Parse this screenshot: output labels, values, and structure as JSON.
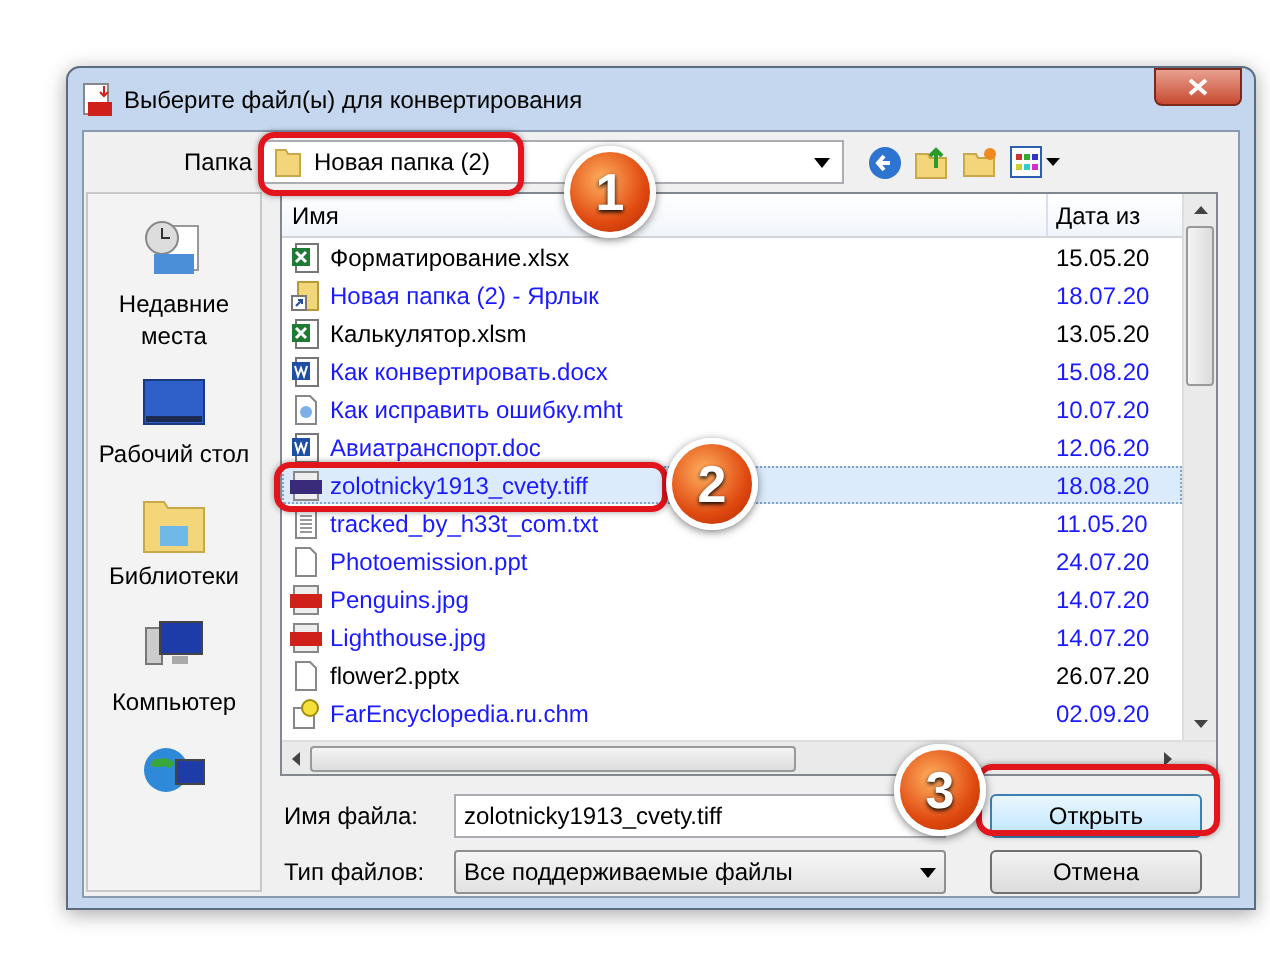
{
  "window": {
    "title": "Выберите файл(ы) для конвертирования"
  },
  "folder": {
    "label": "Папка",
    "value": "Новая папка (2)"
  },
  "places": [
    {
      "kind": "recent",
      "label": "Недавние места"
    },
    {
      "kind": "desktop",
      "label": "Рабочий стол"
    },
    {
      "kind": "libraries",
      "label": "Библиотеки"
    },
    {
      "kind": "computer",
      "label": "Компьютер"
    },
    {
      "kind": "network"
    }
  ],
  "table": {
    "columns": [
      "Имя",
      "Дата из"
    ],
    "rows": [
      {
        "kind": "excel",
        "name": "Форматирование.xlsx",
        "date": "15.05.20",
        "compressed": false,
        "selected": false
      },
      {
        "kind": "shortcut",
        "name": "Новая папка (2) - Ярлык",
        "date": "18.07.20",
        "compressed": true,
        "selected": false
      },
      {
        "kind": "excel",
        "name": "Калькулятор.xlsm",
        "date": "13.05.20",
        "compressed": false,
        "selected": false
      },
      {
        "kind": "word",
        "name": "Как конвертировать.docx",
        "date": "15.08.20",
        "compressed": true,
        "selected": false
      },
      {
        "kind": "web",
        "name": "Как исправить ошибку.mht",
        "date": "10.07.20",
        "compressed": true,
        "selected": false
      },
      {
        "kind": "word",
        "name": "Авиатранспорт.doc",
        "date": "12.06.20",
        "compressed": true,
        "selected": false
      },
      {
        "kind": "tiff",
        "name": "zolotnicky1913_cvety.tiff",
        "date": "18.08.20",
        "compressed": true,
        "selected": true
      },
      {
        "kind": "text",
        "name": "tracked_by_h33t_com.txt",
        "date": "11.05.20",
        "compressed": true,
        "selected": false
      },
      {
        "kind": "blank",
        "name": "Photoemission.ppt",
        "date": "24.07.20",
        "compressed": true,
        "selected": false
      },
      {
        "kind": "jpg",
        "name": "Penguins.jpg",
        "date": "14.07.20",
        "compressed": true,
        "selected": false
      },
      {
        "kind": "jpg",
        "name": "Lighthouse.jpg",
        "date": "14.07.20",
        "compressed": true,
        "selected": false
      },
      {
        "kind": "blank",
        "name": "flower2.pptx",
        "date": "26.07.20",
        "compressed": false,
        "selected": false
      },
      {
        "kind": "help",
        "name": "FarEncyclopedia.ru.chm",
        "date": "02.09.20",
        "compressed": true,
        "selected": false
      }
    ]
  },
  "file_name": {
    "label": "Имя файла:",
    "value": "zolotnicky1913_cvety.tiff"
  },
  "file_type": {
    "label": "Тип файлов:",
    "value": "Все поддерживаемые файлы"
  },
  "buttons": [
    "Открыть",
    "Отмена"
  ],
  "annotations": [
    "1",
    "2",
    "3"
  ]
}
